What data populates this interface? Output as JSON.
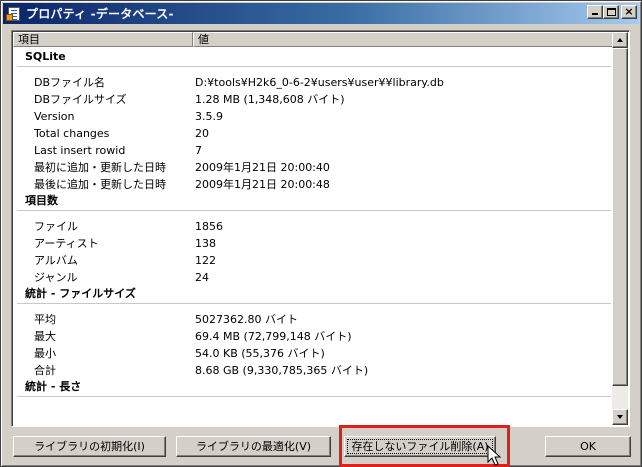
{
  "window": {
    "title": "プロパティ -データベース-",
    "caption_buttons": {
      "minimize": "minimize-icon",
      "maximize": "maximize-icon",
      "close": "×"
    }
  },
  "list": {
    "columns": [
      "項目",
      "値"
    ],
    "sections": [
      {
        "title": "SQLite",
        "rows": [
          {
            "key": "DBファイル名",
            "value": "D:¥tools¥H2k6_0-6-2¥users¥user¥¥library.db"
          },
          {
            "key": "DBファイルサイズ",
            "value": "1.28 MB (1,348,608 バイト)"
          },
          {
            "key": "Version",
            "value": "3.5.9"
          },
          {
            "key": "Total changes",
            "value": "20"
          },
          {
            "key": "Last insert rowid",
            "value": "7"
          },
          {
            "key": "最初に追加・更新した日時",
            "value": "2009年1月21日 20:00:40"
          },
          {
            "key": "最後に追加・更新した日時",
            "value": "2009年1月21日 20:00:48"
          }
        ]
      },
      {
        "title": "項目数",
        "rows": [
          {
            "key": "ファイル",
            "value": "1856"
          },
          {
            "key": "アーティスト",
            "value": "138"
          },
          {
            "key": "アルバム",
            "value": "122"
          },
          {
            "key": "ジャンル",
            "value": "24"
          }
        ]
      },
      {
        "title": "統計 - ファイルサイズ",
        "rows": [
          {
            "key": "平均",
            "value": "5027362.80 バイト"
          },
          {
            "key": "最大",
            "value": "69.4 MB (72,799,148 バイト)"
          },
          {
            "key": "最小",
            "value": "54.0 KB (55,376 バイト)"
          },
          {
            "key": "合計",
            "value": "8.68 GB (9,330,785,365 バイト)"
          }
        ]
      },
      {
        "title": "統計 - 長さ",
        "rows": []
      }
    ]
  },
  "buttons": {
    "init": "ライブラリの初期化(I)",
    "optimize": "ライブラリの最適化(V)",
    "delete_missing": "存在しないファイル削除(A)",
    "ok": "OK"
  },
  "colors": {
    "title_start": "#0a246a",
    "title_end": "#a6caf0",
    "highlight": "#e0201c",
    "face": "#d4d0c8"
  }
}
